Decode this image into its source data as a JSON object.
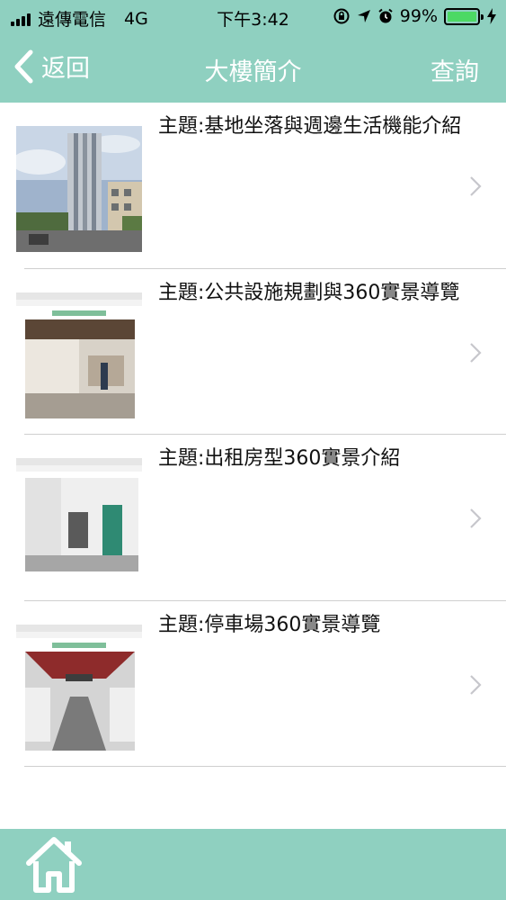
{
  "status_bar": {
    "carrier": "遠傳電信",
    "network": "4G",
    "time": "下午3:42",
    "battery": "99%",
    "battery_level": 0.99,
    "icons": [
      "signal-icon",
      "rotation-lock-icon",
      "location-icon",
      "alarm-icon",
      "battery-icon",
      "charging-icon"
    ]
  },
  "nav": {
    "back_label": "返回",
    "title": "大樓簡介",
    "query_label": "查詢"
  },
  "items": [
    {
      "title": "主題:基地坐落與週邊生活機能介紹",
      "thumbnail": "building-exterior-photo"
    },
    {
      "title": "主題:公共設施規劃與360實景導覽",
      "thumbnail": "lobby-360-screenshot"
    },
    {
      "title": "主題:出租房型360實景介紹",
      "thumbnail": "room-360-screenshot"
    },
    {
      "title": "主題:停車場360實景導覽",
      "thumbnail": "parking-360-screenshot"
    }
  ],
  "tabbar": {
    "home_icon": "home-icon"
  },
  "colors": {
    "accent": "#8fd0c0",
    "text": "#111111",
    "divider": "#cfcfcf",
    "chevron": "#c7c7cc"
  }
}
